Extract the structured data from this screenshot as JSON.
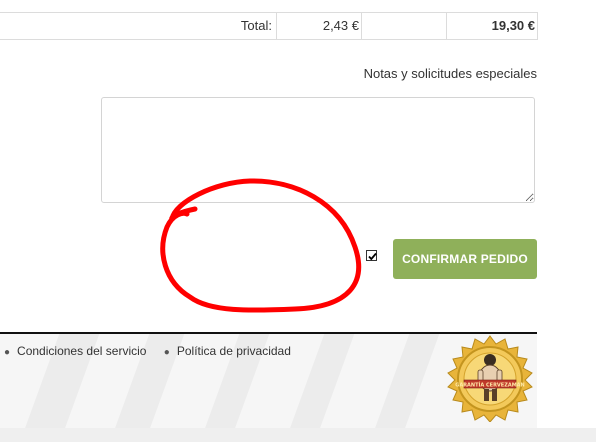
{
  "totals": {
    "label": "Total:",
    "tax": "2,43 €",
    "total": "19,30 €"
  },
  "notes": {
    "label": "Notas y solicitudes especiales",
    "value": ""
  },
  "confirm": {
    "checked": true,
    "button_label": "CONFIRMAR PEDIDO",
    "button_color": "#8fb05a"
  },
  "annotation": {
    "color": "#ff0000",
    "shape": "hand-drawn-circle"
  },
  "footer": {
    "links": [
      {
        "label": "Condiciones del servicio"
      },
      {
        "label": "Política de privacidad"
      }
    ],
    "badge": {
      "text": "GARANTÍA CERVEZAMAN",
      "icon": "mascot-seal-icon"
    }
  }
}
